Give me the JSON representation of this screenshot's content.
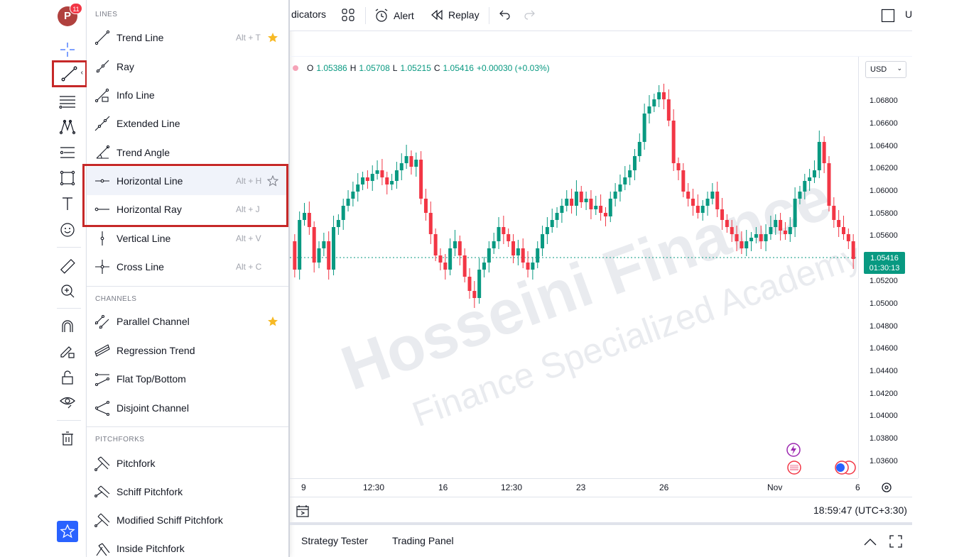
{
  "user": {
    "avatar_letter": "P",
    "badge_count": "11"
  },
  "top_toolbar": {
    "indicators_label": "dicators",
    "alert_label": "Alert",
    "replay_label": "Replay",
    "cut_label": "U"
  },
  "symbol_info": {
    "open_key": "O",
    "open_value": "1.05386",
    "high_key": "H",
    "high_value": "1.05708",
    "low_key": "L",
    "low_value": "1.05215",
    "close_key": "C",
    "close_value": "1.05416",
    "change": "+0.00030 (+0.03%)"
  },
  "currency_select": {
    "value": "USD"
  },
  "menu": {
    "sections": {
      "lines": "LINES",
      "channels": "CHANNELS",
      "pitchforks": "PITCHFORKS"
    },
    "lines": [
      {
        "label": "Trend Line",
        "shortcut": "Alt + T",
        "favorite": true,
        "icon": "trend-line-icon"
      },
      {
        "label": "Ray",
        "shortcut": "",
        "favorite": false,
        "icon": "ray-icon"
      },
      {
        "label": "Info Line",
        "shortcut": "",
        "favorite": false,
        "icon": "info-line-icon"
      },
      {
        "label": "Extended Line",
        "shortcut": "",
        "favorite": false,
        "icon": "extended-line-icon"
      },
      {
        "label": "Trend Angle",
        "shortcut": "",
        "favorite": false,
        "icon": "trend-angle-icon"
      },
      {
        "label": "Horizontal Line",
        "shortcut": "Alt + H",
        "favorite": false,
        "icon": "horizontal-line-icon"
      },
      {
        "label": "Horizontal Ray",
        "shortcut": "Alt + J",
        "favorite": false,
        "icon": "horizontal-ray-icon"
      },
      {
        "label": "Vertical Line",
        "shortcut": "Alt + V",
        "favorite": false,
        "icon": "vertical-line-icon"
      },
      {
        "label": "Cross Line",
        "shortcut": "Alt + C",
        "favorite": false,
        "icon": "cross-line-icon"
      }
    ],
    "channels": [
      {
        "label": "Parallel Channel",
        "favorite": true,
        "icon": "parallel-channel-icon"
      },
      {
        "label": "Regression Trend",
        "favorite": false,
        "icon": "regression-trend-icon"
      },
      {
        "label": "Flat Top/Bottom",
        "favorite": false,
        "icon": "flat-top-bottom-icon"
      },
      {
        "label": "Disjoint Channel",
        "favorite": false,
        "icon": "disjoint-channel-icon"
      }
    ],
    "pitchforks": [
      {
        "label": "Pitchfork",
        "icon": "pitchfork-icon"
      },
      {
        "label": "Schiff Pitchfork",
        "icon": "schiff-pitchfork-icon"
      },
      {
        "label": "Modified Schiff Pitchfork",
        "icon": "modified-schiff-pitchfork-icon"
      },
      {
        "label": "Inside Pitchfork",
        "icon": "inside-pitchfork-icon"
      }
    ]
  },
  "price_scale": {
    "labels": [
      "1.06800",
      "1.06600",
      "1.06400",
      "1.06200",
      "1.06000",
      "1.05800",
      "1.05600",
      "1.05200",
      "1.05000",
      "1.04800",
      "1.04600",
      "1.04400",
      "1.04200",
      "1.04000",
      "1.03800",
      "1.03600"
    ],
    "current_price": "1.05416",
    "countdown": "01:30:13"
  },
  "time_axis": {
    "labels": [
      "9",
      "12:30",
      "16",
      "12:30",
      "23",
      "26",
      "Nov",
      "6"
    ]
  },
  "bottom": {
    "clock": "18:59:47 (UTC+3:30)",
    "tabs": [
      "Strategy Tester",
      "Trading Panel"
    ]
  },
  "watermark": {
    "line1": "Hosseini Finance",
    "line2": "Finance Specialized Academy"
  },
  "colors": {
    "up": "#089981",
    "down": "#f23645",
    "highlight": "#c62828",
    "accent": "#2962ff",
    "star": "#f7b924"
  }
}
